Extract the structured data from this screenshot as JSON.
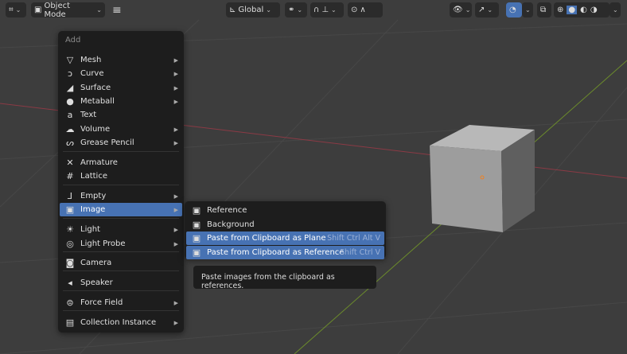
{
  "header": {
    "mode_label": "Object Mode",
    "transform_orientation": "Global"
  },
  "add_menu": {
    "title": "Add",
    "items": [
      {
        "label": "Mesh",
        "icon": "mesh-icon",
        "glyph": "▽",
        "submenu": true
      },
      {
        "label": "Curve",
        "icon": "curve-icon",
        "glyph": "ↄ",
        "submenu": true
      },
      {
        "label": "Surface",
        "icon": "surface-icon",
        "glyph": "◢",
        "submenu": true
      },
      {
        "label": "Metaball",
        "icon": "metaball-icon",
        "glyph": "●",
        "submenu": true
      },
      {
        "label": "Text",
        "icon": "text-icon",
        "glyph": "a",
        "submenu": false
      },
      {
        "label": "Volume",
        "icon": "volume-icon",
        "glyph": "☁",
        "submenu": true
      },
      {
        "label": "Grease Pencil",
        "icon": "grease-pencil-icon",
        "glyph": "ᔕ",
        "submenu": true
      },
      {
        "label": "Armature",
        "icon": "armature-icon",
        "glyph": "✕",
        "submenu": false
      },
      {
        "label": "Lattice",
        "icon": "lattice-icon",
        "glyph": "#",
        "submenu": false
      },
      {
        "label": "Empty",
        "icon": "empty-icon",
        "glyph": "⅃",
        "submenu": true
      },
      {
        "label": "Image",
        "icon": "image-icon",
        "glyph": "▣",
        "submenu": true
      },
      {
        "label": "Light",
        "icon": "light-icon",
        "glyph": "☀",
        "submenu": true
      },
      {
        "label": "Light Probe",
        "icon": "light-probe-icon",
        "glyph": "◎",
        "submenu": true
      },
      {
        "label": "Camera",
        "icon": "camera-icon",
        "glyph": "◙",
        "submenu": false
      },
      {
        "label": "Speaker",
        "icon": "speaker-icon",
        "glyph": "◂",
        "submenu": false
      },
      {
        "label": "Force Field",
        "icon": "force-field-icon",
        "glyph": "⊜",
        "submenu": true
      },
      {
        "label": "Collection Instance",
        "icon": "collection-icon",
        "glyph": "▤",
        "submenu": true
      }
    ]
  },
  "image_submenu": {
    "items": [
      {
        "label": "Reference",
        "shortcut": ""
      },
      {
        "label": "Background",
        "shortcut": ""
      },
      {
        "label": "Paste from Clipboard as Plane",
        "shortcut": "Shift Ctrl Alt V"
      },
      {
        "label": "Paste from Clipboard as Reference",
        "shortcut": "Shift Ctrl V"
      }
    ]
  },
  "tooltip": "Paste images from the clipboard as references.",
  "colors": {
    "accent": "#4772b3",
    "menu_bg": "#1d1d1d",
    "viewport": "#3d3d3d"
  }
}
